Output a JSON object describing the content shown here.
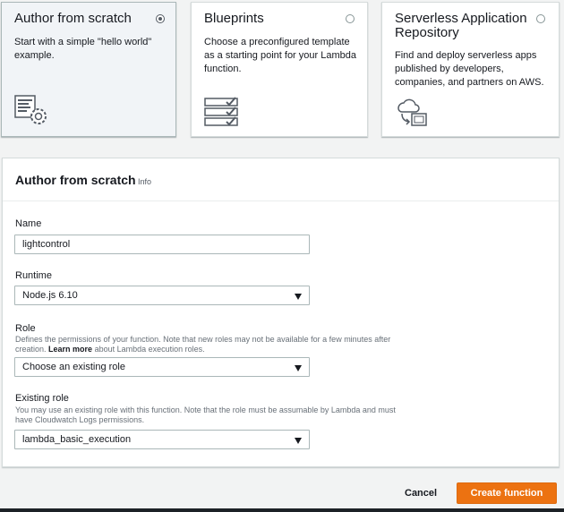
{
  "options": {
    "author": {
      "title": "Author from scratch",
      "description": "Start with a simple \"hello world\" example.",
      "selected": true,
      "icon": "code-gear-icon"
    },
    "blueprints": {
      "title": "Blueprints",
      "description": "Choose a preconfigured template as a starting point for your Lambda function.",
      "selected": false,
      "icon": "blueprint-stack-icon"
    },
    "serverless": {
      "title": "Serverless Application Repository",
      "description": "Find and deploy serverless apps published by developers, companies, and partners on AWS.",
      "selected": false,
      "icon": "cloud-deploy-icon"
    }
  },
  "panel": {
    "title": "Author from scratch",
    "info_link": "Info"
  },
  "form": {
    "name": {
      "label": "Name",
      "value": "lightcontrol"
    },
    "runtime": {
      "label": "Runtime",
      "value": "Node.js 6.10"
    },
    "role": {
      "label": "Role",
      "hint_before": "Defines the permissions of your function. Note that new roles may not be available for a few minutes after creation. ",
      "hint_link": "Learn more",
      "hint_after": " about Lambda execution roles.",
      "value": "Choose an existing role"
    },
    "existing_role": {
      "label": "Existing role",
      "hint": "You may use an existing role with this function. Note that the role must be assumable by Lambda and must have Cloudwatch Logs permissions.",
      "value": "lambda_basic_execution"
    }
  },
  "actions": {
    "cancel": "Cancel",
    "create": "Create function"
  },
  "colors": {
    "primary_button": "#ec7211",
    "page_background": "#f2f3f3"
  }
}
